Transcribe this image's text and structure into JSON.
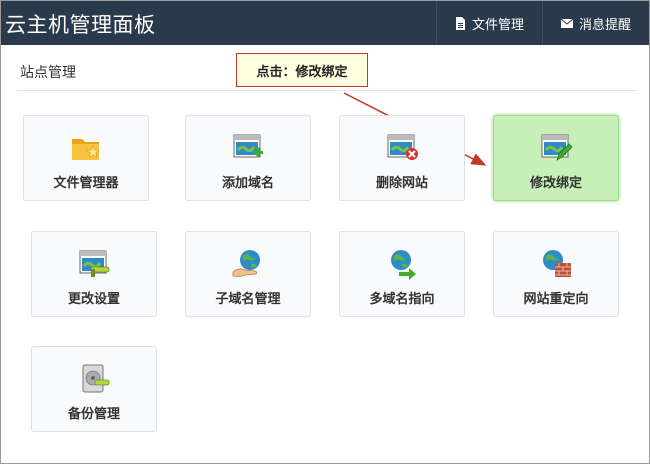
{
  "header": {
    "brand": "云主机管理面板",
    "nav": [
      {
        "label": "文件管理",
        "icon": "file-icon"
      },
      {
        "label": "消息提醒",
        "icon": "mail-icon"
      }
    ]
  },
  "section": {
    "title": "站点管理"
  },
  "tooltip": {
    "text": "点击：修改绑定"
  },
  "tiles": [
    {
      "label": "文件管理器",
      "icon": "folder-star-icon"
    },
    {
      "label": "添加域名",
      "icon": "window-add-icon"
    },
    {
      "label": "删除网站",
      "icon": "window-delete-icon"
    },
    {
      "label": "修改绑定",
      "icon": "window-edit-icon",
      "active": true
    },
    {
      "label": "更改设置",
      "icon": "window-settings-icon"
    },
    {
      "label": "子域名管理",
      "icon": "globe-hand-icon"
    },
    {
      "label": "多域名指向",
      "icon": "globe-arrow-icon"
    },
    {
      "label": "网站重定向",
      "icon": "globe-wall-icon"
    },
    {
      "label": "备份管理",
      "icon": "disk-backup-icon"
    }
  ],
  "colors": {
    "header_bg": "#2b3a4a",
    "active_tile": "#c6f0b8",
    "tooltip_border": "#c0392b",
    "arrow": "#c0392b"
  }
}
